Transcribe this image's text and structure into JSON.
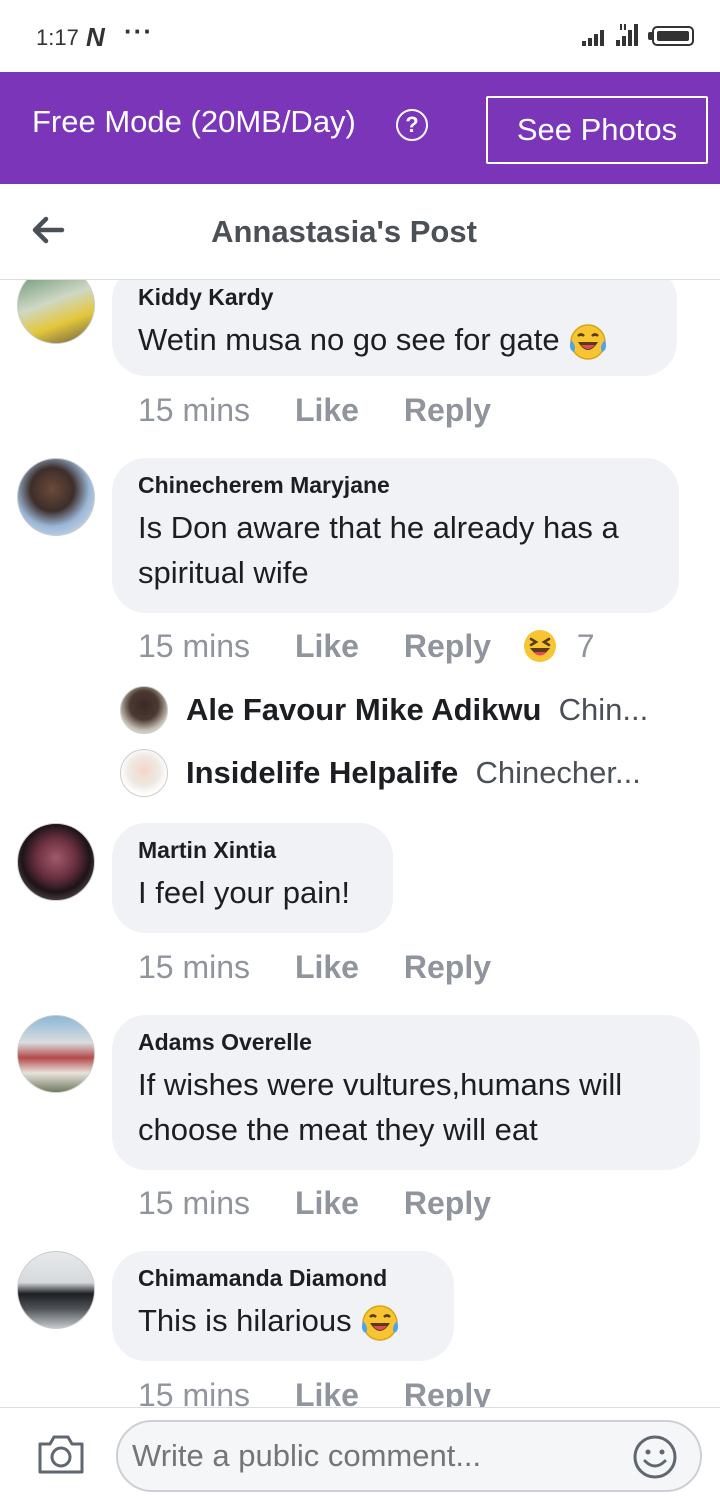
{
  "status_bar": {
    "time": "1:17",
    "n_icon": "N",
    "dots": "···"
  },
  "banner": {
    "text": "Free Mode (20MB/Day)",
    "help": "?",
    "button": "See Photos",
    "color": "#7b35b8"
  },
  "header": {
    "title": "Annastasia's Post"
  },
  "actions": {
    "like": "Like",
    "reply": "Reply"
  },
  "comments": [
    {
      "author": "Kiddy Kardy",
      "text": "Wetin musa no go see for gate",
      "emoji": "laughing-tears",
      "time": "15 mins"
    },
    {
      "author": "Chinecherem Maryjane",
      "text_line1": "Is Don aware that he already has a",
      "text_line2": "spiritual wife",
      "time": "15 mins",
      "reaction": "laughing-squint",
      "reaction_count": "7",
      "replies": [
        {
          "name": "Ale Favour Mike Adikwu",
          "snippet": "Chin..."
        },
        {
          "name": "Insidelife Helpalife",
          "snippet": "Chinecher..."
        }
      ]
    },
    {
      "author": "Martin Xintia",
      "text": "I feel your pain!",
      "time": "15 mins"
    },
    {
      "author": "Adams Overelle",
      "text_line1": "If wishes were vultures,humans will",
      "text_line2": "choose the meat they will eat",
      "time": "15 mins"
    },
    {
      "author": "Chimamanda Diamond",
      "text": "This is hilarious",
      "emoji": "laughing-tears",
      "time": "15 mins"
    }
  ],
  "composer": {
    "placeholder": "Write a public comment..."
  }
}
